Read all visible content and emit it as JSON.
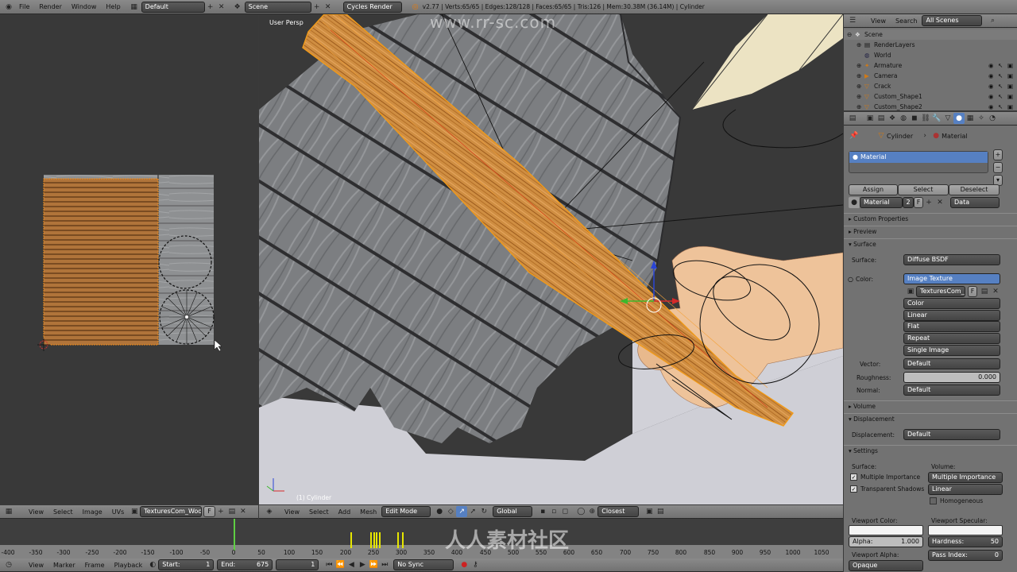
{
  "top_bar": {
    "menus": [
      "File",
      "Render",
      "Window",
      "Help"
    ],
    "layout": "Default",
    "scene": "Scene",
    "engine": "Cycles Render",
    "stats": "v2.77 | Verts:65/65 | Edges:128/128 | Faces:65/65 | Tris:126 | Mem:30.38M (36.14M) | Cylinder"
  },
  "uv_editor": {
    "menus": [
      "View",
      "Select",
      "Image",
      "UVs"
    ],
    "image_name": "TexturesCom_Wood...",
    "image_flag": "F"
  },
  "viewport": {
    "label": "User Persp",
    "object_label": "(1) Cylinder",
    "watermark": "www.rr-sc.com",
    "menus": [
      "View",
      "Select",
      "Add",
      "Mesh"
    ],
    "mode": "Edit Mode",
    "orientation": "Global",
    "snap": "Closest"
  },
  "timeline": {
    "ticks": [
      "-400",
      "-350",
      "-300",
      "-250",
      "-200",
      "-150",
      "-100",
      "-50",
      "0",
      "50",
      "100",
      "150",
      "200",
      "250",
      "300",
      "350",
      "400",
      "450",
      "500",
      "550",
      "600",
      "650",
      "700",
      "750",
      "800",
      "850",
      "900",
      "950",
      "1000",
      "1050"
    ],
    "menus": [
      "View",
      "Marker",
      "Frame",
      "Playback"
    ],
    "start_label": "Start:",
    "start": "1",
    "end_label": "End:",
    "end": "675",
    "current": "1",
    "sync": "No Sync"
  },
  "outliner": {
    "menus": [
      "View",
      "Search"
    ],
    "filter": "All Scenes",
    "items": [
      {
        "label": "Scene",
        "indent": 0
      },
      {
        "label": "RenderLayers",
        "indent": 1
      },
      {
        "label": "World",
        "indent": 1
      },
      {
        "label": "Armature",
        "indent": 1
      },
      {
        "label": "Camera",
        "indent": 1
      },
      {
        "label": "Crack",
        "indent": 1
      },
      {
        "label": "Custom_Shape1",
        "indent": 1
      },
      {
        "label": "Custom_Shape2",
        "indent": 1
      }
    ]
  },
  "properties": {
    "breadcrumb_object": "Cylinder",
    "breadcrumb_material": "Material",
    "slot": "Material",
    "assign": "Assign",
    "select": "Select",
    "deselect": "Deselect",
    "material_name": "Material",
    "users": "2",
    "flag": "F",
    "link": "Data",
    "panels": {
      "custom": "Custom Properties",
      "preview": "Preview",
      "surface": "Surface",
      "volume": "Volume",
      "displacement": "Displacement",
      "settings": "Settings"
    },
    "surface_label": "Surface:",
    "surface_value": "Diffuse BSDF",
    "color_label": "Color:",
    "color_value": "Image Texture",
    "texture_name": "TexturesCom_...",
    "texture_opts": [
      "Color",
      "Linear",
      "Flat",
      "Repeat",
      "Single Image"
    ],
    "vector_label": "Vector:",
    "vector_value": "Default",
    "roughness_label": "Roughness:",
    "roughness_value": "0.000",
    "normal_label": "Normal:",
    "normal_value": "Default",
    "disp_label": "Displacement:",
    "disp_value": "Default",
    "settings_surface": "Surface:",
    "settings_volume": "Volume:",
    "mis": "Multiple Importance",
    "volume_sampling": "Multiple Importance",
    "transparent_shadows": "Transparent Shadows",
    "interp": "Linear",
    "homogeneous": "Homogeneous",
    "viewport_color": "Viewport Color:",
    "viewport_specular": "Viewport Specular:",
    "alpha_label": "Alpha:",
    "alpha_value": "1.000",
    "hardness_label": "Hardness:",
    "hardness_value": "50",
    "viewport_alpha": "Viewport Alpha:",
    "pass_index_label": "Pass Index:",
    "pass_index_value": "0",
    "opaque": "Opaque"
  },
  "watermark_cn": "人人素材社区",
  "colors": {
    "accent": "#5680c2",
    "header": "#7f7f7f",
    "panel": "#727272",
    "uv_bg": "#393939",
    "floor": "#cfcfd6"
  }
}
